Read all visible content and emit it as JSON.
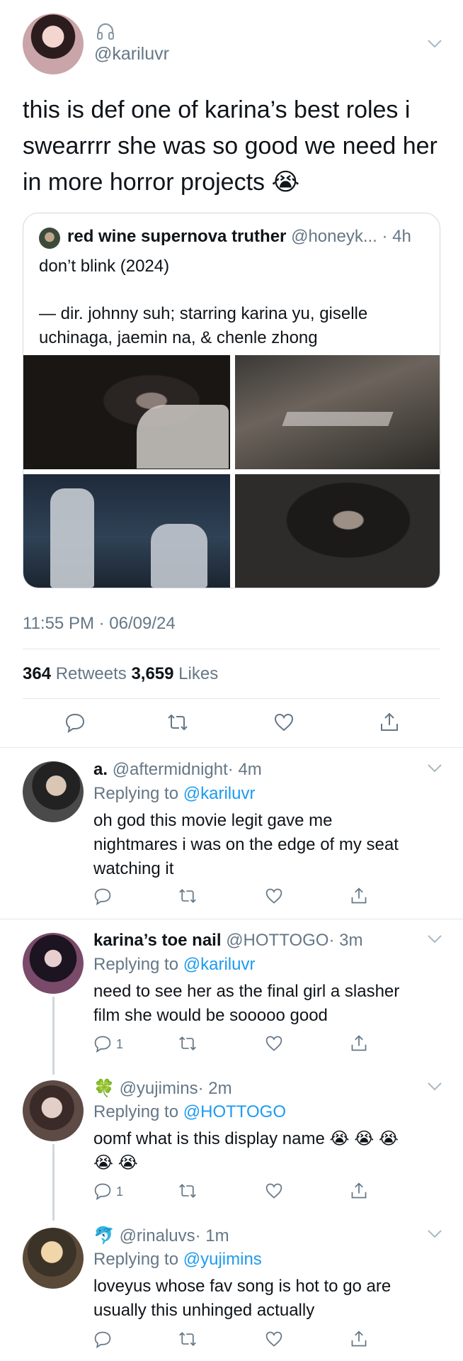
{
  "main_tweet": {
    "handle": "@kariluvr",
    "text_lines": [
      "this is def one of karina’s best roles i",
      "swearrrr she was so good we need her",
      "in more horror projects 😭"
    ],
    "quote": {
      "name": "red wine supernova truther",
      "handle": "@honeyk...",
      "time": "· 4h",
      "line1": "don’t blink (2024)",
      "line2": "— dir. johnny suh; starring karina yu, giselle",
      "line3": "uchinaga, jaemin na, & chenle zhong"
    },
    "timestamp": "11:55 PM · 06/09/24",
    "retweets_count": "364",
    "retweets_label": "Retweets",
    "likes_count": "3,659",
    "likes_label": "Likes"
  },
  "replies": [
    {
      "name": "a.",
      "handle": "@aftermidnight",
      "time": "· 4m",
      "replying_label": "Replying to",
      "replying_to": "@kariluvr",
      "text_lines": [
        "oh god this movie legit gave me",
        "nightmares i was on the edge of my seat",
        "watching it"
      ],
      "reply_count": ""
    },
    {
      "name": "karina’s toe nail",
      "handle": "@HOTTOGO",
      "time": "· 3m",
      "replying_label": "Replying to",
      "replying_to": "@kariluvr",
      "text_lines": [
        "need to see her as the final girl a slasher",
        "film she would be sooooo good"
      ],
      "reply_count": "1"
    },
    {
      "name": "🍀",
      "handle": "@yujimins",
      "time": "· 2m",
      "replying_label": "Replying to",
      "replying_to": "@HOTTOGO",
      "text_lines": [
        "oomf what is this display name 😭 😭 😭",
        "😭 😭"
      ],
      "reply_count": "1"
    },
    {
      "name": "🐬",
      "handle": "@rinaluvs",
      "time": "· 1m",
      "replying_label": "Replying to",
      "replying_to": "@yujimins",
      "text_lines": [
        "loveyus whose fav song is hot to go are",
        "usually this unhinged actually"
      ],
      "reply_count": ""
    }
  ],
  "icons": [
    "headphones-icon",
    "chevron-down-icon",
    "reply-icon",
    "retweet-icon",
    "like-icon",
    "share-icon"
  ],
  "colors": {
    "link": "#1d9bf0",
    "secondary": "#657786",
    "divider": "#e1e8ed"
  }
}
